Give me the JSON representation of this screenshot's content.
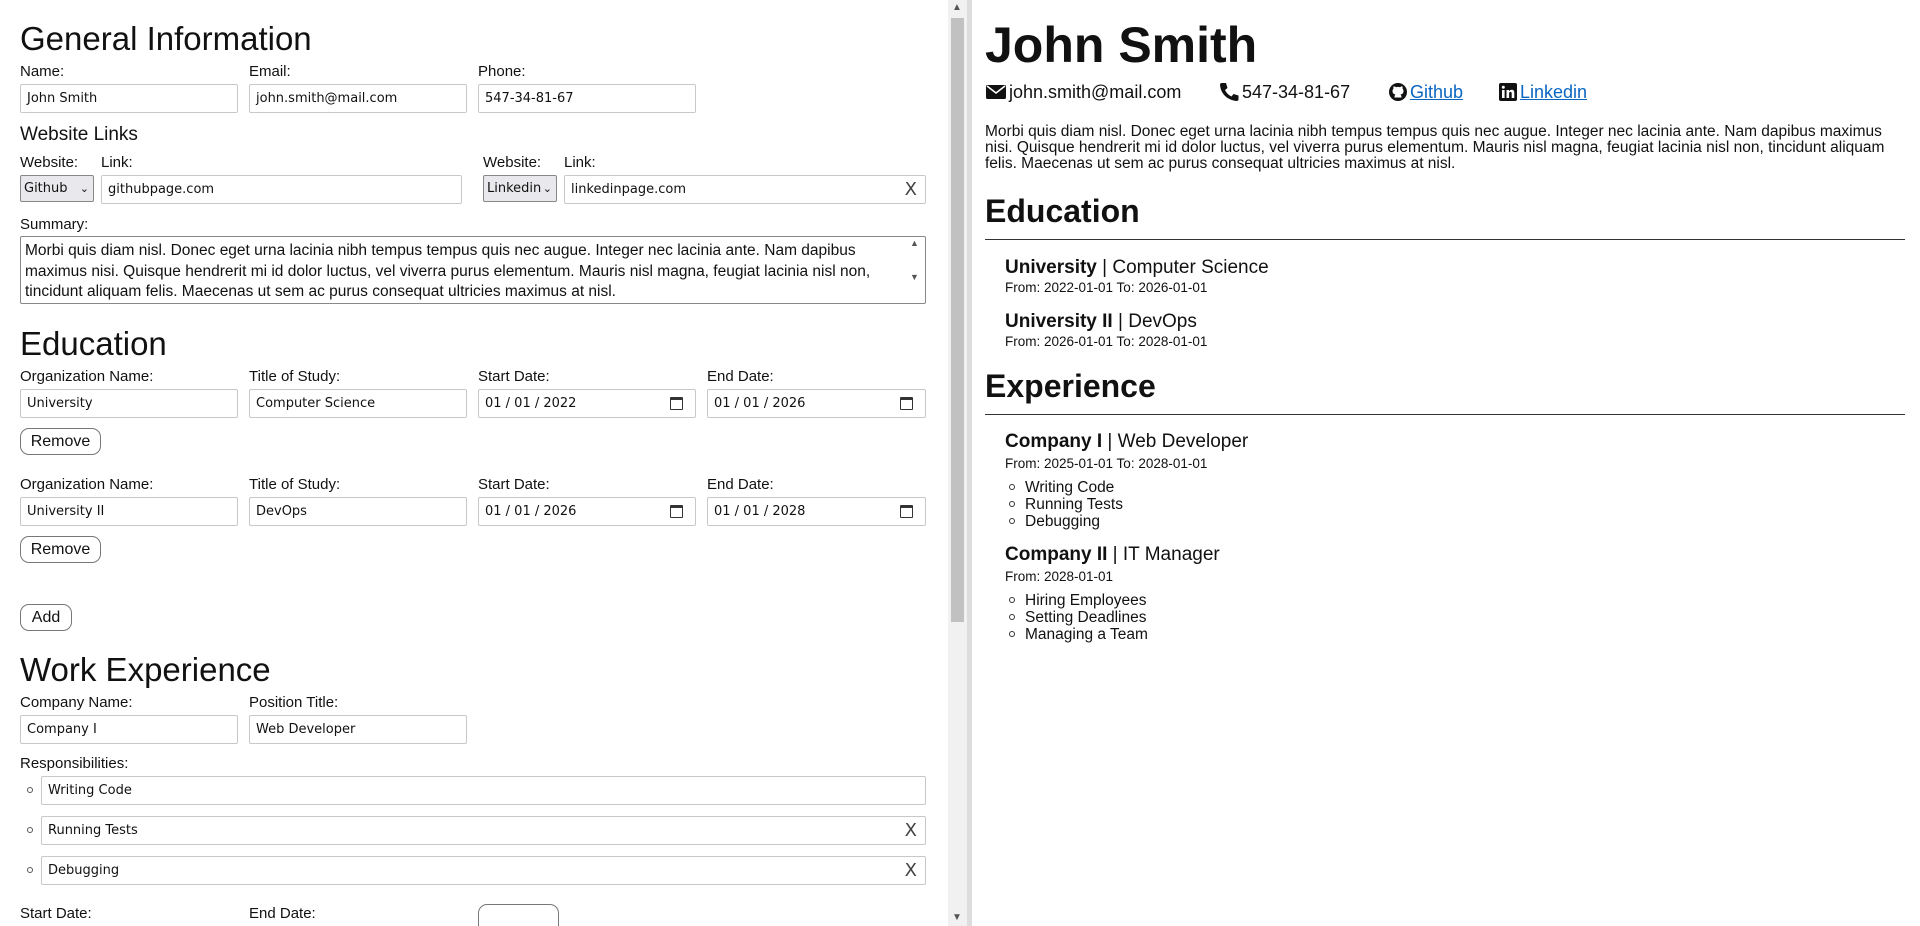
{
  "general": {
    "title": "General Information",
    "name_label": "Name:",
    "name_value": "John Smith",
    "email_label": "Email:",
    "email_value": "john.smith@mail.com",
    "phone_label": "Phone:",
    "phone_value": "547-34-81-67"
  },
  "links": {
    "title": "Website Links",
    "website_label": "Website:",
    "link_label": "Link:",
    "items": [
      {
        "site": "Github",
        "url": "githubpage.com"
      },
      {
        "site": "Linkedin",
        "url": "linkedinpage.com"
      }
    ],
    "clear_glyph": "X"
  },
  "summary": {
    "label": "Summary:",
    "text": "Morbi quis diam nisl. Donec eget urna lacinia nibh tempus tempus quis nec augue. Integer nec lacinia ante. Nam dapibus maximus nisi. Quisque hendrerit mi id dolor luctus, vel viverra purus elementum. Mauris nisl magna, feugiat lacinia nisl non, tincidunt aliquam felis. Maecenas ut sem ac purus consequat ultricies maximus at nisl."
  },
  "education": {
    "title": "Education",
    "org_label": "Organization Name:",
    "study_label": "Title of Study:",
    "start_label": "Start Date:",
    "end_label": "End Date:",
    "remove_label": "Remove",
    "add_label": "Add",
    "items": [
      {
        "org": "University",
        "study": "Computer Science",
        "start": "01 / 01 / 2022",
        "end": "01 / 01 / 2026"
      },
      {
        "org": "University II",
        "study": "DevOps",
        "start": "01 / 01 / 2026",
        "end": "01 / 01 / 2028"
      }
    ]
  },
  "work": {
    "title": "Work Experience",
    "company_label": "Company Name:",
    "position_label": "Position Title:",
    "company_value": "Company I",
    "position_value": "Web Developer",
    "resp_label": "Responsibilities:",
    "responsibilities": [
      "Writing Code",
      "Running Tests",
      "Debugging"
    ],
    "start_label": "Start Date:",
    "end_label": "End Date:",
    "clear_glyph": "X"
  },
  "preview": {
    "name": "John Smith",
    "email": "john.smith@mail.com",
    "phone": "547-34-81-67",
    "links": [
      "Github",
      "Linkedin"
    ],
    "summary": "Morbi quis diam nisl. Donec eget urna lacinia nibh tempus tempus quis nec augue. Integer nec lacinia ante. Nam dapibus maximus nisi. Quisque hendrerit mi id dolor luctus, vel viverra purus elementum. Mauris nisl magna, feugiat lacinia nisl non, tincidunt aliquam felis. Maecenas ut sem ac purus consequat ultricies maximus at nisl.",
    "education_title": "Education",
    "education": [
      {
        "org": "University",
        "sep": " | ",
        "study": "Computer Science",
        "dates": "From: 2022-01-01 To: 2026-01-01"
      },
      {
        "org": "University II",
        "sep": " | ",
        "study": "DevOps",
        "dates": "From: 2026-01-01 To: 2028-01-01"
      }
    ],
    "experience_title": "Experience",
    "experience": [
      {
        "company": "Company I",
        "sep": " | ",
        "position": "Web Developer",
        "dates": "From: 2025-01-01 To: 2028-01-01",
        "items": [
          "Writing Code",
          "Running Tests",
          "Debugging"
        ]
      },
      {
        "company": "Company II",
        "sep": " | ",
        "position": "IT Manager",
        "dates": "From: 2028-01-01",
        "items": [
          "Hiring Employees",
          "Setting Deadlines",
          "Managing a Team"
        ]
      }
    ]
  },
  "colors": {
    "link": "#0a66c2",
    "rule": "#333333",
    "scroll_thumb": "#c1c1c1"
  }
}
